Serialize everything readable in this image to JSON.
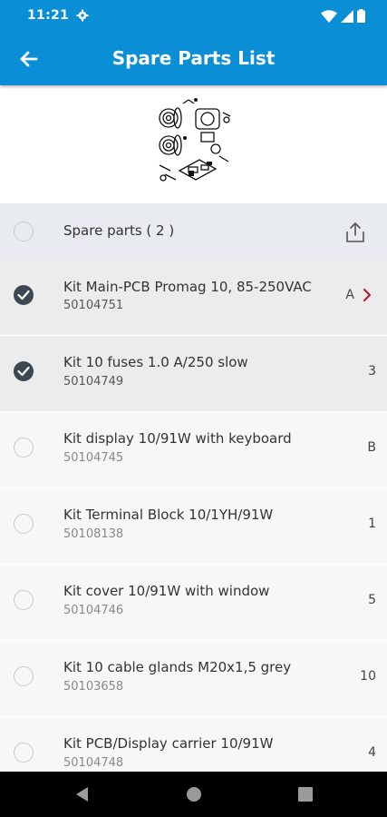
{
  "status": {
    "time": "11:21"
  },
  "appbar": {
    "title": "Spare Parts List"
  },
  "header_row": {
    "label": "Spare parts ( 2 )"
  },
  "items": [
    {
      "name": "Kit Main-PCB Promag 10, 85-250VAC",
      "number": "50104751",
      "qty": "A",
      "checked": true,
      "has_chevron": true
    },
    {
      "name": "Kit 10 fuses 1.0 A/250 slow",
      "number": "50104749",
      "qty": "3",
      "checked": true
    },
    {
      "name": "Kit display 10/91W with keyboard",
      "number": "50104745",
      "qty": "B",
      "checked": false
    },
    {
      "name": "Kit Terminal Block 10/1YH/91W",
      "number": "50108138",
      "qty": "1",
      "checked": false
    },
    {
      "name": "Kit cover 10/91W with window",
      "number": "50104746",
      "qty": "5",
      "checked": false
    },
    {
      "name": "Kit 10 cable glands M20x1,5 grey",
      "number": "50103658",
      "qty": "10",
      "checked": false
    },
    {
      "name": "Kit PCB/Display carrier 10/91W",
      "number": "50104748",
      "qty": "4",
      "checked": false
    }
  ],
  "colors": {
    "appbar": "#0a8fd6",
    "check": "#3e4853",
    "chevron": "#b5122e"
  }
}
